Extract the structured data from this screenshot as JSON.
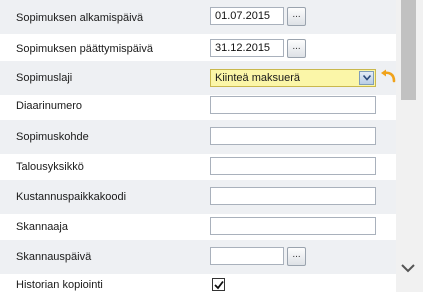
{
  "fields": {
    "start_date": {
      "label": "Sopimuksen alkamispäivä",
      "value": "01.07.2015",
      "picker": "..."
    },
    "end_date": {
      "label": "Sopimuksen päättymispäivä",
      "value": "31.12.2015",
      "picker": "..."
    },
    "contract_type": {
      "label": "Sopimuslaji",
      "value": "Kiinteä maksuerä"
    },
    "record_number": {
      "label": "Diaarinumero",
      "value": ""
    },
    "contract_object": {
      "label": "Sopimuskohde",
      "value": ""
    },
    "finance_unit": {
      "label": "Talousyksikkö",
      "value": ""
    },
    "cost_center": {
      "label": "Kustannuspaikkakoodi",
      "value": ""
    },
    "scanner": {
      "label": "Skannaaja",
      "value": ""
    },
    "scan_date": {
      "label": "Skannauspäivä",
      "value": "",
      "picker": "..."
    },
    "history_copy": {
      "label": "Historian kopiointi",
      "checked": true
    }
  },
  "colors": {
    "row_shade": "#eef0f3",
    "select_highlight": "#fbf6a8",
    "undo_arrow": "#f0a21a"
  },
  "icons": {
    "dropdown": "chevron-down-icon",
    "undo": "undo-arrow-icon",
    "check": "check-icon",
    "scroll_down": "scroll-down-icon"
  }
}
